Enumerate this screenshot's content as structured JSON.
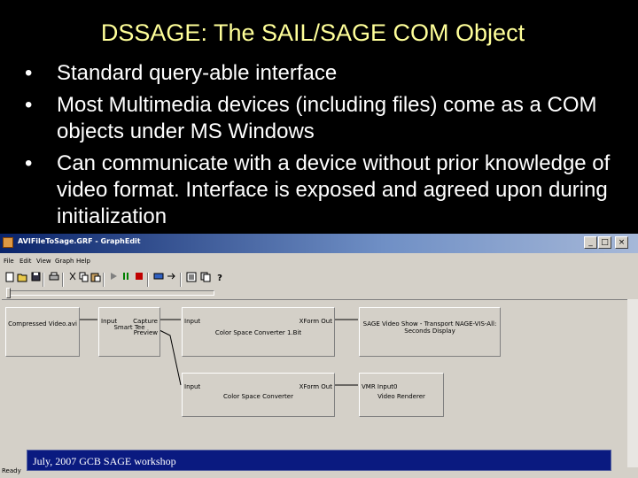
{
  "slide": {
    "title": "DSSAGE: The SAIL/SAGE COM Object",
    "bullets": [
      "Standard query-able interface",
      "Most Multimedia devices (including files) come as a COM objects under MS Windows",
      "Can communicate with a device without prior knowledge of video format. Interface is exposed and agreed upon during initialization"
    ],
    "bullet_symbol": "•",
    "footer": "July, 2007 GCB SAGE workshop"
  },
  "window": {
    "title": "AVIFileToSage.GRF - GraphEdit",
    "controls": {
      "minimize": "_",
      "maximize": "□",
      "close": "×"
    },
    "menu": [
      "File",
      "Edit",
      "View",
      "Graph",
      "Help"
    ],
    "toolbar_icons": [
      "new-icon",
      "open-icon",
      "save-icon",
      "print-icon",
      "cut-icon",
      "copy-icon",
      "paste-icon",
      "play-icon",
      "pause-icon",
      "stop-icon",
      "insert-filter-icon",
      "render-icon",
      "properties-icon",
      "help-icon"
    ],
    "toolbar_help_glyph": "?",
    "filters": [
      {
        "name": "Compressed Video.avi",
        "out": "(unlabelled)"
      },
      {
        "name": "Smart Tee",
        "in": "Input",
        "out1": "Capture",
        "out2": "Preview"
      },
      {
        "name": "Color Space Converter 1.Bit",
        "in": "Input",
        "out": "XForm Out"
      },
      {
        "name": "SAGE Video Show - Transport NAGE-VIS-All: Seconds Display",
        "in": "SAGE Video Show - Transport"
      },
      {
        "name": "Color Space Converter",
        "in": "Input",
        "out": "XForm Out"
      },
      {
        "name": "Video Renderer",
        "in": "VMR Input0"
      }
    ],
    "status": "Ready"
  },
  "colors": {
    "title": "#ffff99",
    "text": "#ffffff",
    "background": "#000000",
    "footer_bg": "#0a1a80"
  }
}
